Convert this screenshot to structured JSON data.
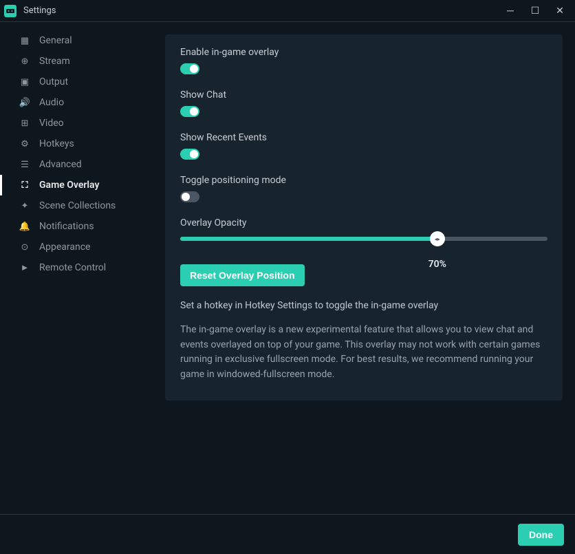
{
  "window": {
    "title": "Settings"
  },
  "sidebar": {
    "items": [
      {
        "label": "General",
        "icon": "grid-icon"
      },
      {
        "label": "Stream",
        "icon": "globe-icon"
      },
      {
        "label": "Output",
        "icon": "output-icon"
      },
      {
        "label": "Audio",
        "icon": "speaker-icon"
      },
      {
        "label": "Video",
        "icon": "film-icon"
      },
      {
        "label": "Hotkeys",
        "icon": "gear-icon"
      },
      {
        "label": "Advanced",
        "icon": "sliders-icon"
      },
      {
        "label": "Game Overlay",
        "icon": "fullscreen-icon",
        "active": true
      },
      {
        "label": "Scene Collections",
        "icon": "palette-icon"
      },
      {
        "label": "Notifications",
        "icon": "bell-icon"
      },
      {
        "label": "Appearance",
        "icon": "eye-icon"
      },
      {
        "label": "Remote Control",
        "icon": "play-circle-icon"
      }
    ]
  },
  "settings": {
    "enable_overlay": {
      "label": "Enable in-game overlay",
      "value": true
    },
    "show_chat": {
      "label": "Show Chat",
      "value": true
    },
    "show_events": {
      "label": "Show Recent Events",
      "value": true
    },
    "toggle_pos": {
      "label": "Toggle positioning mode",
      "value": false
    },
    "opacity": {
      "label": "Overlay Opacity",
      "value": 70,
      "display": "70%"
    },
    "reset_btn": "Reset Overlay Position",
    "info": "Set a hotkey in Hotkey Settings to toggle the in-game overlay",
    "description": "The in-game overlay is a new experimental feature that allows you to view chat and events overlayed on top of your game. This overlay may not work with certain games running in exclusive fullscreen mode. For best results, we recommend running your game in windowed-fullscreen mode."
  },
  "footer": {
    "done": "Done"
  }
}
